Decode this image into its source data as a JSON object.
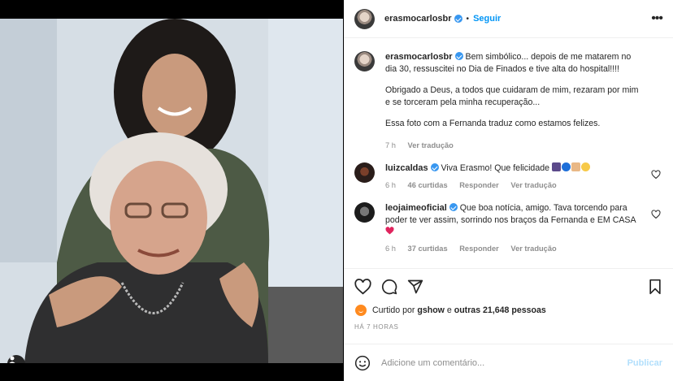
{
  "post": {
    "author": "erasmocarlosbr",
    "follow_label": "Seguir",
    "more_label": "•••",
    "caption_paragraphs": [
      "Bem simbólico... depois de me matarem no dia 30, ressuscitei no Dia de Finados e tive alta do hospital!!!!",
      "Obrigado a Deus, a todos que cuidaram de mim, rezaram por mim e se torceram pela minha recuperação...",
      "Essa foto com a Fernanda traduz como estamos felizes."
    ],
    "caption_time": "7 h",
    "see_translation": "Ver tradução"
  },
  "comments": [
    {
      "user": "luizcaldas",
      "text": "Viva Erasmo! Que felicidade",
      "emoji_icons": [
        "people-icon",
        "blue-heart-icon",
        "praying-hands-icon",
        "smiling-face-icon"
      ],
      "time": "6 h",
      "likes": "46 curtidas",
      "reply": "Responder",
      "translate": "Ver tradução"
    },
    {
      "user": "leojaimeoficial",
      "text": "Que boa notícia, amigo. Tava torcendo para poder te ver assim, sorrindo nos braços da Fernanda e EM CASA",
      "emoji_icons": [
        "red-heart-icon"
      ],
      "time": "6 h",
      "likes": "37 curtidas",
      "reply": "Responder",
      "translate": "Ver tradução"
    }
  ],
  "engagement": {
    "liked_by_prefix": "Curtido por",
    "liked_by_user": "gshow",
    "liked_by_and": "e",
    "liked_by_others": "outras 21,648 pessoas",
    "timestamp": "HÁ 7 HORAS"
  },
  "comment_form": {
    "placeholder": "Adicione um comentário...",
    "publish_label": "Publicar"
  },
  "colors": {
    "accent": "#0095f6",
    "verified": "#3897f0",
    "muted": "#8e8e8e",
    "publish_disabled": "#b2dffc",
    "like_heart": "#ed4956"
  }
}
